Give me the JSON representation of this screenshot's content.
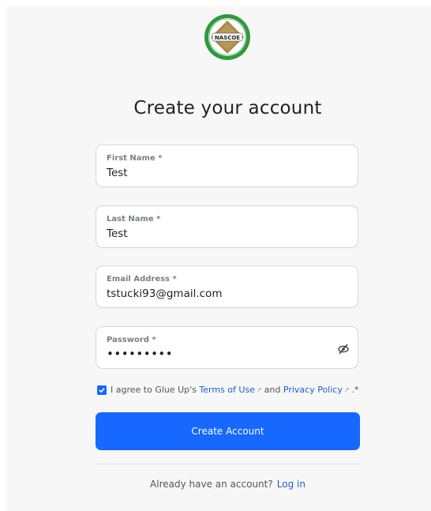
{
  "logo": {
    "text": "NASCOE",
    "icon": "nascoe-seal-logo"
  },
  "title": "Create your account",
  "fields": [
    {
      "label": "First Name *",
      "value": "Test"
    },
    {
      "label": "Last Name *",
      "value": "Test"
    },
    {
      "label": "Email Address *",
      "value": "tstucki93@gmail.com"
    },
    {
      "label": "Password *",
      "value": "•••••••••",
      "icon": "eye-slash-icon"
    }
  ],
  "agree": {
    "checked": true,
    "prefix": "I agree to Glue Up's",
    "terms": "Terms of Use",
    "and": "and",
    "privacy": "Privacy Policy",
    "suffix": ".*"
  },
  "create_button": "Create Account",
  "login": {
    "prompt": "Already have an account?",
    "link": "Log in"
  },
  "colors": {
    "primary": "#1668ff",
    "link": "#1a5fd0",
    "background": "#f7f7f8"
  }
}
